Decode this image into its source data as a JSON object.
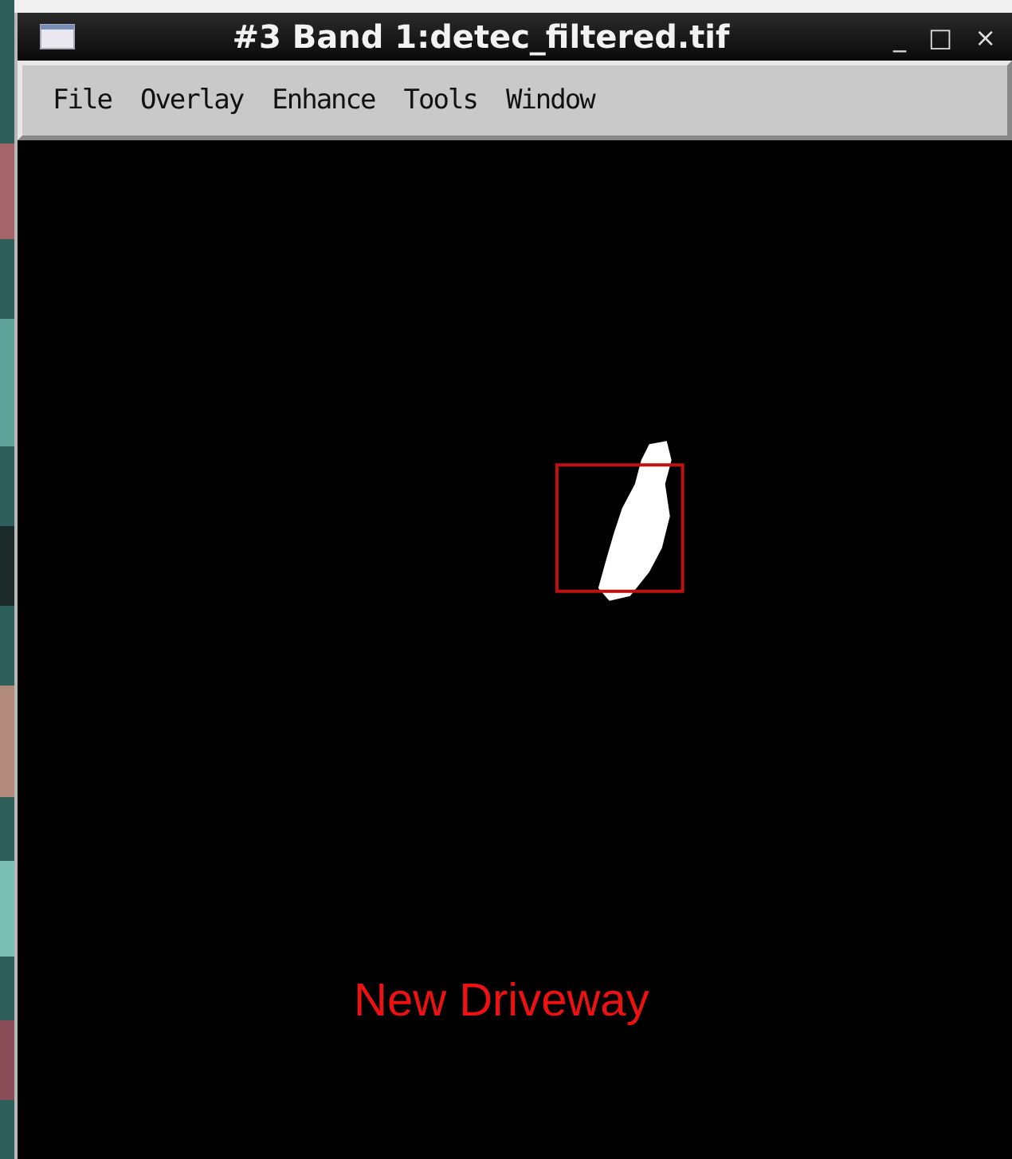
{
  "window": {
    "title": "#3 Band 1:detec_filtered.tif",
    "controls": [
      "_",
      "□",
      "×"
    ]
  },
  "menu": [
    "File",
    "Overlay",
    "Enhance",
    "Tools",
    "Window"
  ],
  "image": {
    "caption": "New Driveway"
  }
}
